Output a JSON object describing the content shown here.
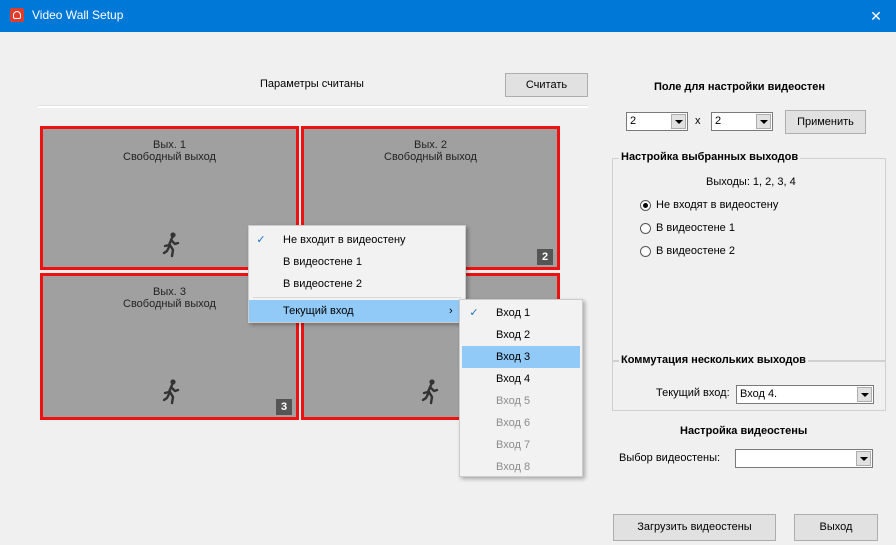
{
  "window": {
    "title": "Video Wall Setup",
    "close_glyph": "✕"
  },
  "top": {
    "status": "Параметры считаны",
    "read_button": "Считать"
  },
  "cells": [
    {
      "title": "Вых. 1",
      "subtitle": "Свободный выход",
      "badge": ""
    },
    {
      "title": "Вых. 2",
      "subtitle": "Свободный выход",
      "badge": "2"
    },
    {
      "title": "Вых. 3",
      "subtitle": "Свободный выход",
      "badge": "3"
    },
    {
      "title": "",
      "subtitle": "",
      "badge": ""
    }
  ],
  "context_menu": {
    "items": [
      {
        "label": "Не входит в видеостену",
        "checked": true
      },
      {
        "label": "В видеостене 1",
        "checked": false
      },
      {
        "label": "В видеостене 2",
        "checked": false
      },
      {
        "label": "Текущий вход",
        "submenu_arrow": "›"
      }
    ]
  },
  "submenu": {
    "items": [
      {
        "label": "Вход 1",
        "checked": true,
        "enabled": true
      },
      {
        "label": "Вход 2",
        "checked": false,
        "enabled": true
      },
      {
        "label": "Вход 3",
        "checked": false,
        "enabled": true,
        "highlighted": true
      },
      {
        "label": "Вход 4",
        "checked": false,
        "enabled": true
      },
      {
        "label": "Вход 5",
        "checked": false,
        "enabled": false
      },
      {
        "label": "Вход 6",
        "checked": false,
        "enabled": false
      },
      {
        "label": "Вход 7",
        "checked": false,
        "enabled": false
      },
      {
        "label": "Вход 8",
        "checked": false,
        "enabled": false
      }
    ]
  },
  "wall_config": {
    "title": "Поле для настройки видеостен",
    "rows": "2",
    "x_sep": "x",
    "cols": "2",
    "apply_button": "Применить"
  },
  "selected_outputs": {
    "group_label": "Настройка выбранных выходов",
    "outputs_text": "Выходы: 1, 2, 3, 4",
    "radios": [
      {
        "label": "Не входят в видеостену",
        "selected": true
      },
      {
        "label": "В видеостене 1",
        "selected": false
      },
      {
        "label": "В видеостене 2",
        "selected": false
      }
    ]
  },
  "multi_switch": {
    "group_label": "Коммутация нескольких выходов",
    "current_input_label": "Текущий вход:",
    "current_input_value": "Вход 4."
  },
  "video_wall": {
    "title": "Настройка видеостены",
    "select_label": "Выбор видеостены:",
    "select_value": ""
  },
  "bottom": {
    "load_button": "Загрузить видеостены",
    "exit_button": "Выход"
  },
  "colors": {
    "titlebar": "#0078d7",
    "cell_border": "#ee1111",
    "cell_bg": "#a0a0a0",
    "menu_highlight": "#91c9f7"
  }
}
